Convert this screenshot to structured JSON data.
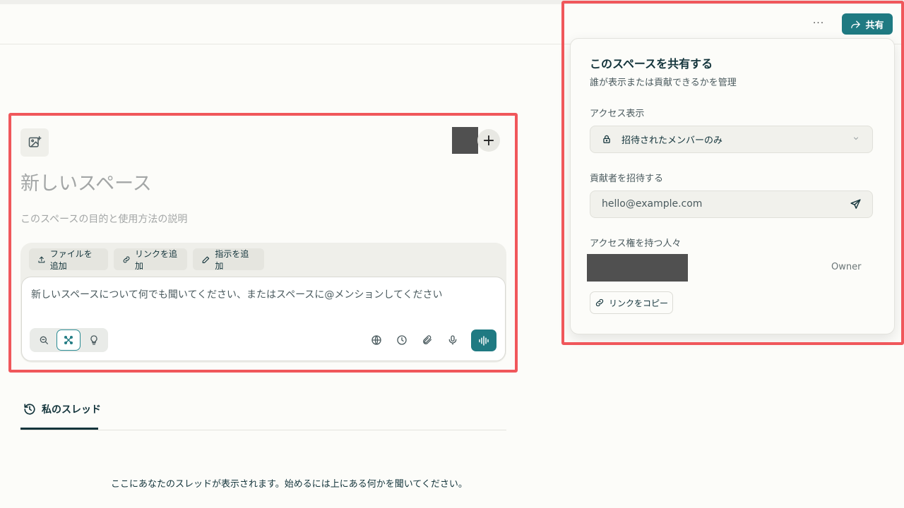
{
  "header": {
    "more_label": "···",
    "share_label": "共有"
  },
  "space": {
    "title": "新しいスペース",
    "description": "このスペースの目的と使用方法の説明",
    "chips": {
      "add_file": "ファイルを追加",
      "add_link": "リンクを追加",
      "add_instructions": "指示を追加"
    },
    "composer_placeholder": "新しいスペースについて何でも聞いてください、またはスペースに@メンションしてください",
    "modes": [
      "search-icon",
      "research-icon",
      "lightbulb-icon"
    ],
    "tools": [
      "globe-icon",
      "clock-icon",
      "paperclip-icon",
      "microphone-icon"
    ],
    "add_member_label": "+"
  },
  "threads": {
    "tab_label": "私のスレッド",
    "empty_message": "ここにあなたのスレッドが表示されます。始めるには上にある何かを聞いてください。"
  },
  "share_popover": {
    "title": "このスペースを共有する",
    "subtitle": "誰が表示または貢献できるかを管理",
    "access_label": "アクセス表示",
    "access_value": "招待されたメンバーのみ",
    "invite_label": "貢献者を招待する",
    "invite_value": "hello@example.com",
    "people_label": "アクセス権を持つ人々",
    "member_role": "Owner",
    "copy_link_label": "リンクをコピー"
  },
  "colors": {
    "accent": "#1f7a82",
    "highlight_box": "#f0575b",
    "background": "#fcfcf9"
  }
}
